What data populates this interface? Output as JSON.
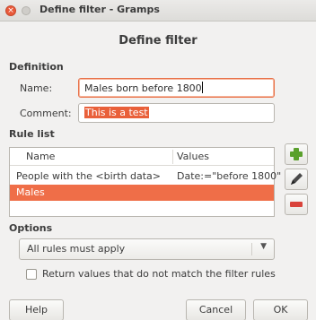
{
  "window": {
    "title": "Define filter - Gramps",
    "close_glyph": "×"
  },
  "dialog": {
    "title": "Define filter"
  },
  "definition": {
    "heading": "Definition",
    "name_label": "Name:",
    "name_value": "Males born before 1800",
    "comment_label": "Comment:",
    "comment_value": "This is a test"
  },
  "rules": {
    "heading": "Rule list",
    "columns": [
      "Name",
      "Values"
    ],
    "rows": [
      {
        "name": "People with the <birth data>",
        "values": "Date:=\"before 1800\""
      },
      {
        "name": "Males",
        "values": ""
      }
    ],
    "selected_index": 1
  },
  "side_buttons": [
    "add-icon",
    "edit-icon",
    "remove-icon"
  ],
  "options": {
    "heading": "Options",
    "mode_value": "All rules must apply",
    "invert_label": "Return values that do not match the filter rules",
    "invert_checked": false
  },
  "buttons": {
    "help": "Help",
    "cancel": "Cancel",
    "ok": "OK"
  },
  "colors": {
    "accent": "#ef6e48",
    "add": "#5aa02c",
    "remove": "#d9433b"
  }
}
